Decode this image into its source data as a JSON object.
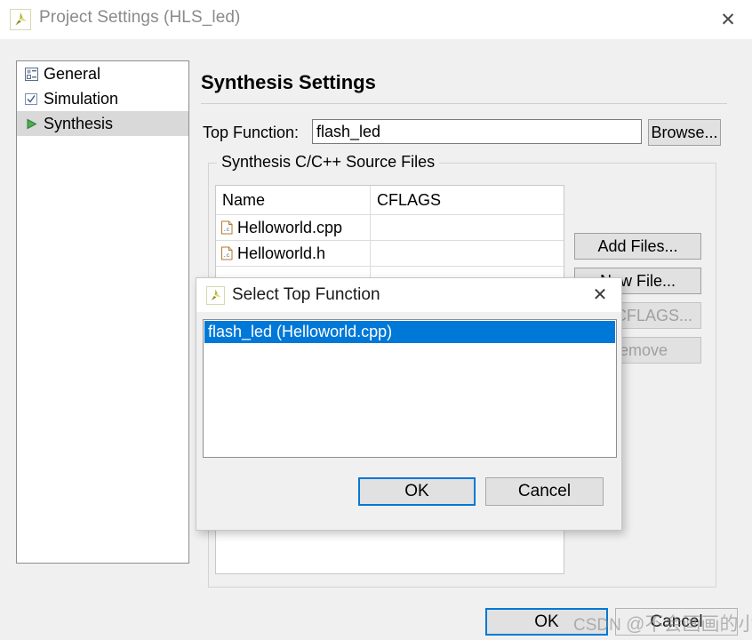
{
  "window": {
    "title": "Project Settings (HLS_led)",
    "logo_icon": "vivado-hls-logo-icon",
    "close_icon": "close-icon",
    "close_glyph": "✕"
  },
  "sidebar": {
    "items": [
      {
        "label": "General",
        "icon": "properties-list-icon",
        "selected": false
      },
      {
        "label": "Simulation",
        "icon": "checkbox-checked-icon",
        "selected": false
      },
      {
        "label": "Synthesis",
        "icon": "green-play-icon",
        "selected": true
      }
    ]
  },
  "panel": {
    "title": "Synthesis Settings",
    "top_function": {
      "label": "Top Function:",
      "value": "flash_led",
      "placeholder": "",
      "browse_label": "Browse..."
    },
    "group": {
      "legend": "Synthesis C/C++ Source Files",
      "columns": [
        "Name",
        "CFLAGS"
      ],
      "rows": [
        {
          "name": "Helloworld.cpp",
          "cflags": "",
          "icon": "c-file-icon"
        },
        {
          "name": "Helloworld.h",
          "cflags": "",
          "icon": "c-file-icon"
        }
      ],
      "buttons": [
        {
          "label": "Add Files...",
          "enabled": true
        },
        {
          "label": "New File...",
          "enabled": true
        },
        {
          "label": "Edit CFLAGS...",
          "enabled": false
        },
        {
          "label": "Remove",
          "enabled": false
        }
      ]
    }
  },
  "footer": {
    "ok_label": "OK",
    "cancel_label": "Cancel"
  },
  "modal": {
    "title": "Select Top Function",
    "logo_icon": "vivado-hls-logo-icon",
    "close_icon": "close-icon",
    "close_glyph": "✕",
    "list": [
      {
        "label": "flash_led (Helloworld.cpp)",
        "selected": true
      }
    ],
    "ok_label": "OK",
    "cancel_label": "Cancel"
  },
  "watermark": {
    "brand": "CSDN",
    "handle": "@不会画画的小易"
  },
  "colors": {
    "accent_blue": "#0078d7",
    "window_bg": "#f0f0f0",
    "selection_gray": "#d9d9d9",
    "button_face": "#e1e1e1",
    "logo_olive": "#a8a820"
  }
}
